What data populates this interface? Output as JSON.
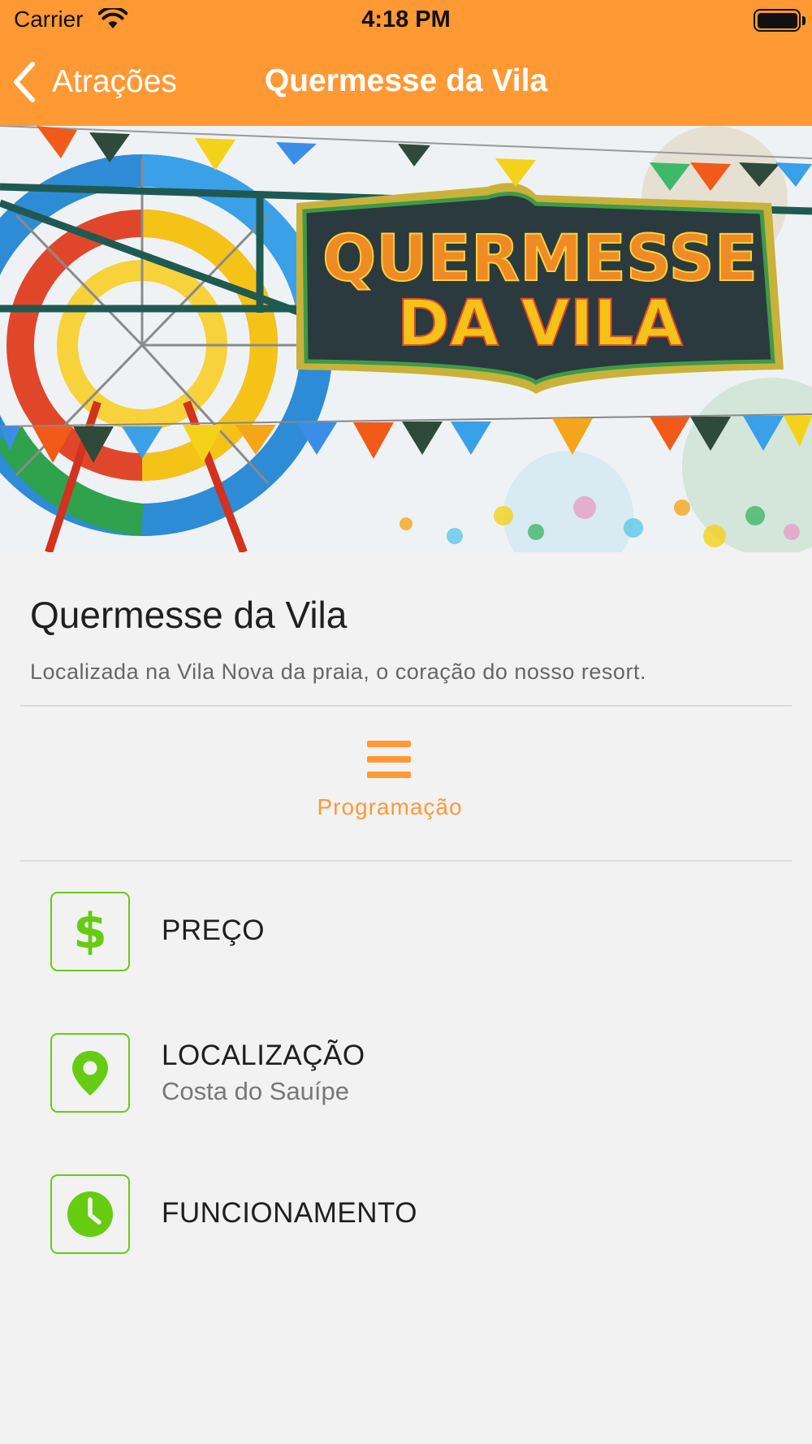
{
  "status_bar": {
    "carrier": "Carrier",
    "time": "4:18 PM"
  },
  "nav": {
    "back_label": "Atrações",
    "title": "Quermesse da Vila"
  },
  "hero": {
    "sign_line1": "QUERMESSE",
    "sign_line2": "DA VILA"
  },
  "attraction": {
    "title": "Quermesse da Vila",
    "description": "Localizada na Vila Nova da praia, o coração do nosso resort."
  },
  "schedule_button": {
    "label": "Programação",
    "icon": "menu-icon"
  },
  "info": {
    "price": {
      "label": "PREÇO",
      "icon": "dollar-icon"
    },
    "location": {
      "label": "LOCALIZAÇÃO",
      "value": "Costa do Sauípe",
      "icon": "map-pin-icon"
    },
    "hours": {
      "label": "FUNCIONAMENTO",
      "icon": "clock-icon"
    }
  },
  "colors": {
    "accent": "#ff9933",
    "icon_green": "#66cc11",
    "background": "#f2f2f2"
  }
}
